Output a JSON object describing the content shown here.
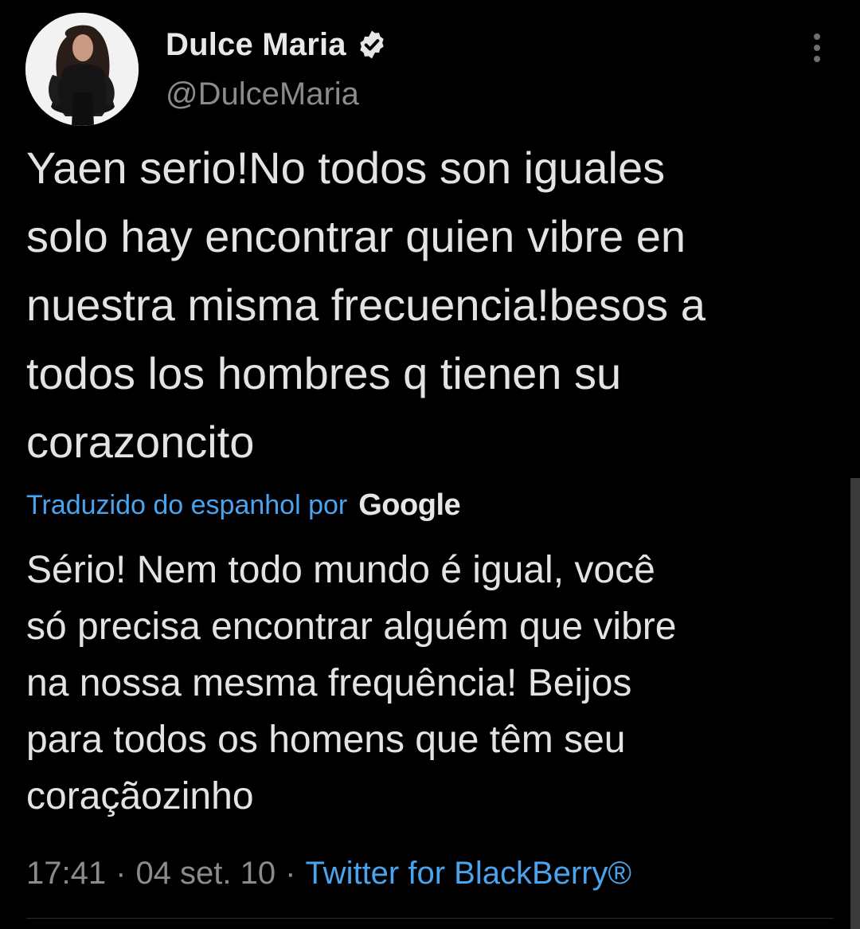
{
  "author": {
    "display_name": "Dulce Maria",
    "handle": "@DulceMaria",
    "avatar_icon": "profile-photo",
    "verified_icon": "verified-badge-icon"
  },
  "tweet": {
    "text_lines": [
      "Yaen serio!No todos son iguales",
      "solo hay encontrar quien vibre en",
      "nuestra misma frecuencia!besos a",
      "todos los hombres q tienen su",
      "corazoncito"
    ]
  },
  "translation": {
    "label": "Traduzido do espanhol por",
    "provider": "Google",
    "text_lines": [
      "Sério! Nem todo mundo é igual, você",
      "só precisa encontrar alguém que vibre",
      "na nossa mesma frequência! Beijos",
      "para todos os homens que têm seu",
      "coraçãozinho"
    ]
  },
  "meta": {
    "time": "17:41",
    "date": "04 set. 10",
    "separator": "·",
    "source": "Twitter for BlackBerry®"
  },
  "colors": {
    "background": "#000000",
    "link_blue": "#4aa3ee",
    "muted_gray": "#8b8b8b",
    "text": "#e3e3e3"
  }
}
